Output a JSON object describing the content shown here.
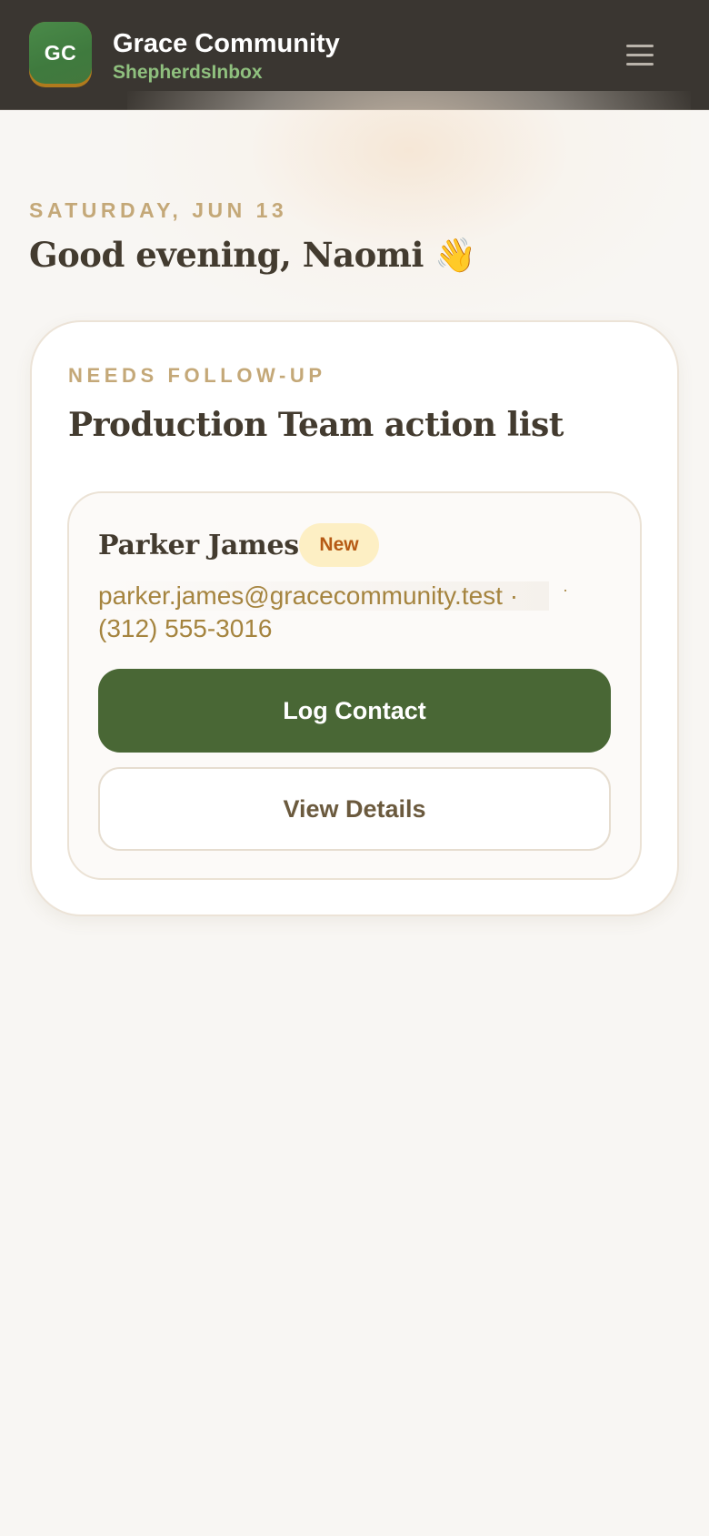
{
  "header": {
    "logo_initials": "GC",
    "title": "Grace Community",
    "subtitle": "ShepherdsInbox",
    "menu_icon": "hamburger-menu-icon"
  },
  "greeting": {
    "date": "SATURDAY, JUN 13",
    "text": "Good evening, Naomi",
    "emoji": "👋"
  },
  "follow_up": {
    "label": "NEEDS FOLLOW-UP",
    "title": "Production Team action list",
    "contact": {
      "name": "Parker James",
      "status": "New",
      "email": "parker.james@gracecommunity.test",
      "separator": "·",
      "phone": "(312) 555-3016",
      "primary_action": "Log Contact",
      "secondary_action": "View Details"
    }
  },
  "colors": {
    "header_bg": "#3a3631",
    "brand_green": "#496735",
    "subtitle_green": "#8fc07e",
    "accent_gold": "#c4a878",
    "link_gold": "#a5843f",
    "badge_bg": "#fdefc4",
    "badge_text": "#b65a14",
    "heading": "#433b2f",
    "page_bg": "#f8f6f3"
  }
}
